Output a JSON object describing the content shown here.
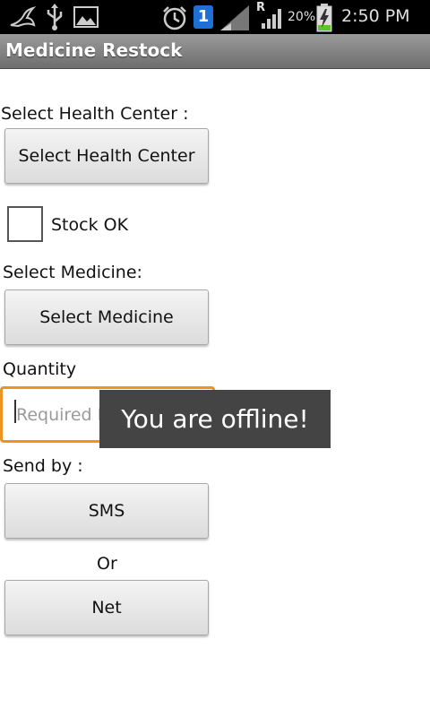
{
  "status_bar": {
    "time": "2:50 PM",
    "battery_percent": "20%",
    "roaming": "R",
    "notification_badge": "1",
    "icons": [
      "bird-icon",
      "usb-icon",
      "image-icon",
      "alarm-icon",
      "notification-icon",
      "signal-empty-icon",
      "signal-icon",
      "battery-charging-icon"
    ]
  },
  "app": {
    "title": "Medicine Restock"
  },
  "form": {
    "health_center_label": "Select Health Center :",
    "health_center_button": "Select Health Center",
    "stock_ok_label": "Stock OK",
    "stock_ok_checked": false,
    "medicine_label": "Select Medicine:",
    "medicine_button": "Select Medicine",
    "quantity_label": "Quantity",
    "quantity_placeholder": "Required N",
    "quantity_value": "",
    "send_by_label": "Send by :",
    "sms_button": "SMS",
    "or_label": "Or",
    "net_button": "Net"
  },
  "toast": {
    "message": "You are offline!"
  },
  "colors": {
    "focus_border": "#f0931e",
    "toast_bg": "#444444",
    "titlebar": "#8a8a8a"
  }
}
